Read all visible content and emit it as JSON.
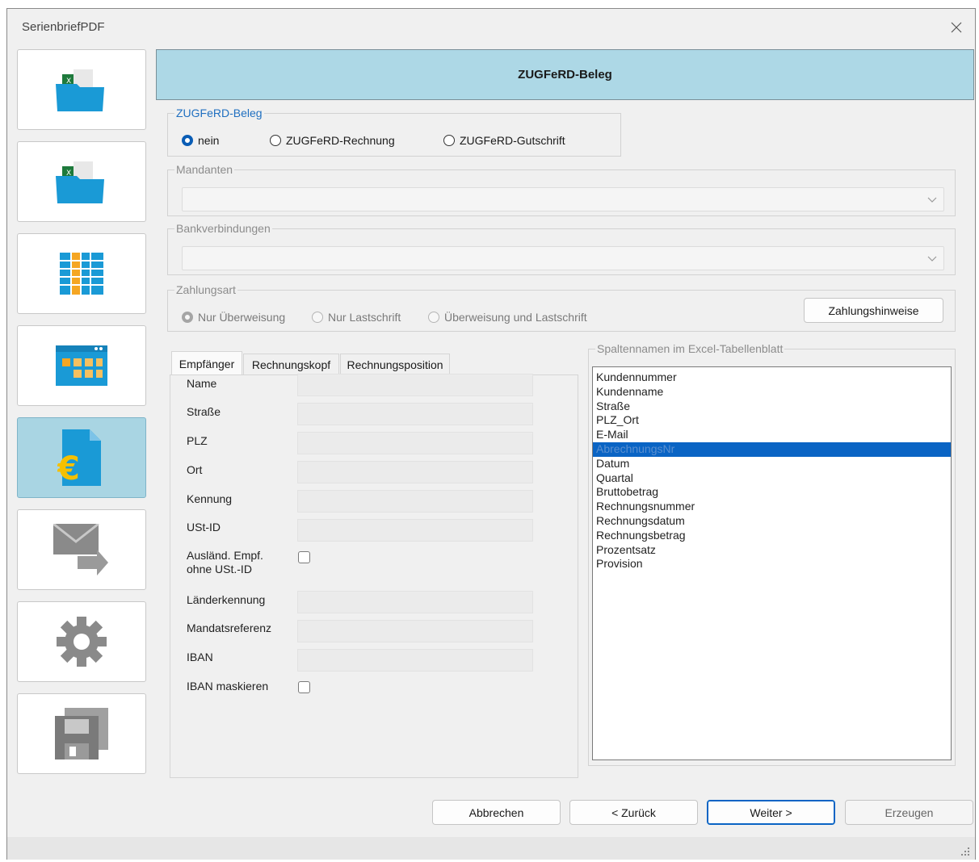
{
  "window": {
    "title": "SerienbriefPDF"
  },
  "header": {
    "title": "ZUGFeRD-Beleg"
  },
  "sidebar": {
    "items": [
      {
        "icon": "excel-folder-icon",
        "active": false
      },
      {
        "icon": "excel-folder-icon",
        "active": false
      },
      {
        "icon": "table-column-icon",
        "active": false
      },
      {
        "icon": "browser-grid-icon",
        "active": false
      },
      {
        "icon": "euro-document-icon",
        "active": true
      },
      {
        "icon": "mail-forward-icon",
        "active": false
      },
      {
        "icon": "gear-icon",
        "active": false
      },
      {
        "icon": "floppy-disk-icon",
        "active": false
      }
    ]
  },
  "zugferd": {
    "legend": "ZUGFeRD-Beleg",
    "options": [
      "nein",
      "ZUGFeRD-Rechnung",
      "ZUGFeRD-Gutschrift"
    ],
    "selected": "nein"
  },
  "mandanten": {
    "legend": "Mandanten",
    "value": ""
  },
  "bank": {
    "legend": "Bankverbindungen",
    "value": ""
  },
  "zahlungsart": {
    "legend": "Zahlungsart",
    "options": [
      "Nur Überweisung",
      "Nur Lastschrift",
      "Überweisung und Lastschrift"
    ],
    "selected": "Nur Überweisung",
    "hint_button": "Zahlungshinweise"
  },
  "tabs": [
    "Empfänger",
    "Rechnungskopf",
    "Rechnungsposition"
  ],
  "active_tab": "Empfänger",
  "fields": {
    "name": "Name",
    "strasse": "Straße",
    "plz": "PLZ",
    "ort": "Ort",
    "kennung": "Kennung",
    "ustid": "USt-ID",
    "auslaend_line1": "Ausländ. Empf.",
    "auslaend_line2": "ohne USt.-ID",
    "laenderkennung": "Länderkennung",
    "mandatsreferenz": "Mandatsreferenz",
    "iban": "IBAN",
    "iban_maskieren": "IBAN maskieren"
  },
  "columns": {
    "legend": "Spaltennamen im Excel-Tabellenblatt",
    "items": [
      "Kundennummer",
      "Kundenname",
      "Straße",
      "PLZ_Ort",
      "E-Mail",
      "AbrechnungsNr",
      "Datum",
      "Quartal",
      "Bruttobetrag",
      "Rechnungsnummer",
      "Rechnungsdatum",
      "Rechnungsbetrag",
      "Prozentsatz",
      "Provision"
    ],
    "selected": "AbrechnungsNr"
  },
  "footer": {
    "cancel": "Abbrechen",
    "back": "< Zurück",
    "next": "Weiter >",
    "generate": "Erzeugen"
  },
  "colors": {
    "accent": "#0a64c4",
    "header_bg": "#add8e6",
    "active_sidebar": "#a9d5e3"
  }
}
